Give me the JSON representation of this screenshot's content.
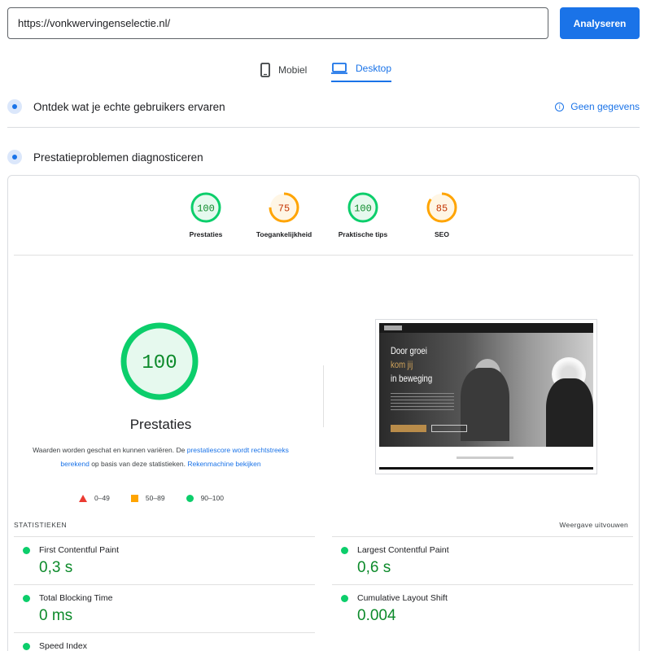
{
  "search": {
    "url": "https://vonkwervingenselectie.nl/",
    "analyze_label": "Analyseren"
  },
  "tabs": [
    {
      "label": "Mobiel",
      "icon": "phone-icon",
      "active": false
    },
    {
      "label": "Desktop",
      "icon": "laptop-icon",
      "active": true
    }
  ],
  "field_data": {
    "title": "Ontdek wat je echte gebruikers ervaren",
    "right_label": "Geen gegevens"
  },
  "lab_data": {
    "title": "Prestatieproblemen diagnosticeren"
  },
  "category_scores": [
    {
      "label": "Prestaties",
      "score": "100",
      "status": "good"
    },
    {
      "label": "Toegankelijkheid",
      "score": "75",
      "status": "average"
    },
    {
      "label": "Praktische tips",
      "score": "100",
      "status": "good"
    },
    {
      "label": "SEO",
      "score": "85",
      "status": "average"
    }
  ],
  "performance": {
    "score": "100",
    "title": "Prestaties",
    "desc_1": "Waarden worden geschat en kunnen variëren. De ",
    "desc_link_1": "prestatiescore wordt rechtstreeks berekend",
    "desc_2": " op basis van deze statistieken. ",
    "desc_link_2": "Rekenmachine bekijken"
  },
  "legend": [
    {
      "range": "0–49",
      "shape": "triangle",
      "color": "#eb3b32"
    },
    {
      "range": "50–89",
      "shape": "square",
      "color": "#ffa400"
    },
    {
      "range": "90–100",
      "shape": "circle",
      "color": "#0cce6b"
    }
  ],
  "thumbnail": {
    "headline_1": "Door groei",
    "headline_2": "kom jij",
    "headline_3": "in beweging"
  },
  "stats": {
    "heading": "STATISTIEKEN",
    "expand_label": "Weergave uitvouwen",
    "metrics": [
      {
        "name": "First Contentful Paint",
        "value": "0,3 s"
      },
      {
        "name": "Largest Contentful Paint",
        "value": "0,6 s"
      },
      {
        "name": "Total Blocking Time",
        "value": "0 ms"
      },
      {
        "name": "Cumulative Layout Shift",
        "value": "0.004"
      },
      {
        "name": "Speed Index",
        "value": ""
      }
    ]
  },
  "colors": {
    "accent": "#1a73e8",
    "good": "#0cce6b",
    "good_text": "#0c8a2a",
    "average": "#ffa400",
    "average_text": "#c33300",
    "poor": "#eb3b32"
  }
}
